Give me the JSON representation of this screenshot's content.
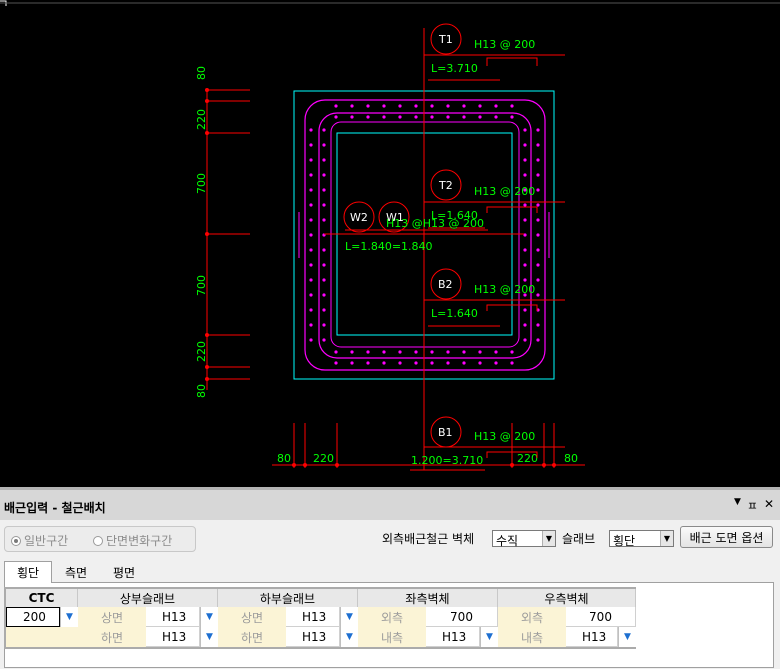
{
  "drawing": {
    "marks": {
      "t1": "T1",
      "t2": "T2",
      "b1": "B1",
      "b2": "B2",
      "w1": "W1",
      "w2": "W2"
    },
    "rebar_labels": {
      "t1": "H13 @ 200",
      "t2": "H13 @ 200",
      "b2": "H13 @ 200",
      "b1": "H13 @ 200",
      "w": "H13 @H13 @ 200"
    },
    "lengths": {
      "t1": "L=3.710",
      "t2": "L=1.640",
      "b2": "L=1.640",
      "w": "L=1.840=1.840",
      "b1": "1.200=3.710"
    },
    "left_dims": [
      "80",
      "220",
      "700",
      "700",
      "220",
      "80"
    ],
    "bottom_dims": {
      "l1": "80",
      "l2": "220",
      "r1": "220",
      "r2": "80"
    }
  },
  "panel": {
    "title": "배근입력 - 철근배치",
    "buttons": {
      "dropdown": "▼",
      "pin": "ㅍ",
      "close": "✕"
    },
    "radio_general": "일반구간",
    "radio_section_change": "단면변화구간",
    "outer_rebar_label": "외측배근철근 벽체",
    "outer_rebar_value": "수직",
    "slab_label": "슬래브",
    "slab_value": "횡단",
    "options_button": "배근 도면 옵션",
    "tabs": [
      "횡단",
      "측면",
      "평면"
    ]
  },
  "grid": {
    "ctc_header": "CTC",
    "ctc_value": "200",
    "upper_slab": "상부슬래브",
    "lower_slab": "하부슬래브",
    "left_wall": "좌측벽체",
    "right_wall": "우측벽체",
    "top_face": "상면",
    "bottom_face": "하면",
    "outer": "외측",
    "inner": "내측",
    "upper_top_value": "H13",
    "upper_bottom_value": "H13",
    "lower_top_value": "H13",
    "lower_bottom_value": "H13",
    "left_outer_value": "700",
    "left_inner_value": "H13",
    "right_outer_value": "700",
    "right_inner_value": "H13"
  },
  "colors": {
    "background": "#000000",
    "dim_red": "#ff0000",
    "text_green": "#00ff00",
    "outline_cyan": "#00ffff",
    "rebar_magenta": "#ff00ff",
    "header_cream": "#fbf4d6",
    "dropdown_blue": "#1e6fd0"
  }
}
